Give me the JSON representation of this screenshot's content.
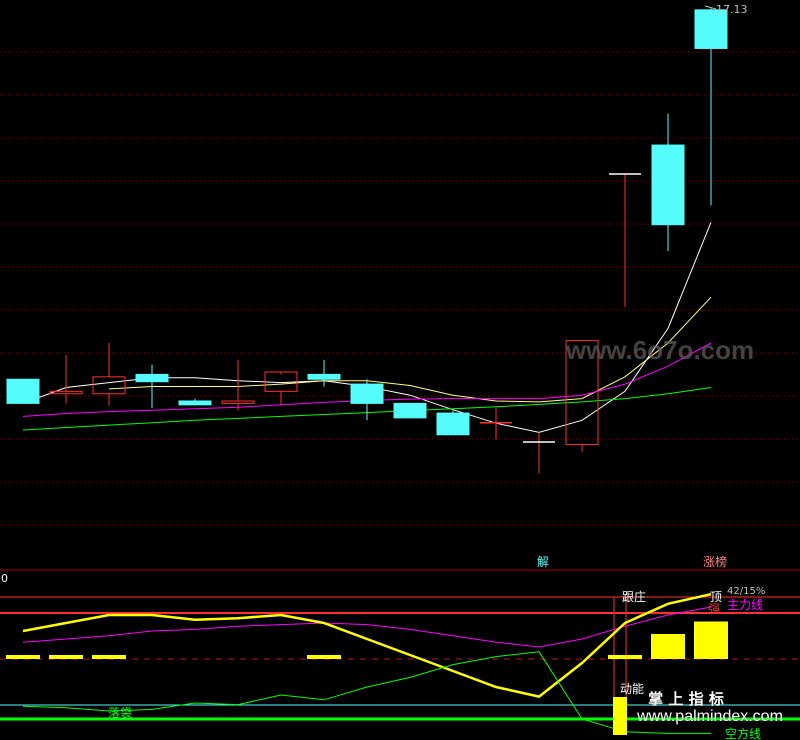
{
  "chart_data": [
    {
      "type": "candlestick",
      "panel": "main",
      "price_label": "17.13",
      "ylim": [
        5.5,
        17.2
      ],
      "candles": [
        {
          "o": 9.45,
          "h": 9.45,
          "l": 8.95,
          "c": 8.95
        },
        {
          "o": 9.15,
          "h": 9.95,
          "l": 8.95,
          "c": 9.2
        },
        {
          "o": 9.15,
          "h": 10.2,
          "l": 8.9,
          "c": 9.5
        },
        {
          "o": 9.55,
          "h": 9.75,
          "l": 8.85,
          "c": 9.4
        },
        {
          "o": 9.0,
          "h": 9.05,
          "l": 8.95,
          "c": 8.92
        },
        {
          "o": 8.95,
          "h": 9.85,
          "l": 8.8,
          "c": 9.0
        },
        {
          "o": 9.2,
          "h": 9.55,
          "l": 8.9,
          "c": 9.6
        },
        {
          "o": 9.55,
          "h": 9.85,
          "l": 9.3,
          "c": 9.45
        },
        {
          "o": 9.35,
          "h": 9.45,
          "l": 8.6,
          "c": 8.95
        },
        {
          "o": 8.95,
          "h": 8.95,
          "l": 8.7,
          "c": 8.65
        },
        {
          "o": 8.75,
          "h": 8.8,
          "l": 8.3,
          "c": 8.3
        },
        {
          "o": 8.55,
          "h": 8.85,
          "l": 8.2,
          "c": 8.55
        },
        {
          "o": 8.15,
          "h": 8.35,
          "l": 7.5,
          "c": 8.15
        },
        {
          "o": 8.1,
          "h": 10.25,
          "l": 7.95,
          "c": 10.25
        },
        {
          "o": 13.7,
          "h": 13.7,
          "l": 10.95,
          "c": 13.7
        },
        {
          "o": 14.3,
          "h": 14.95,
          "l": 12.1,
          "c": 12.65
        },
        {
          "o": 17.1,
          "h": 17.13,
          "l": 13.05,
          "c": 16.3
        }
      ],
      "series": [
        {
          "color": "#FFFFFF",
          "values": [
            8.95,
            9.28,
            9.38,
            9.48,
            9.48,
            9.42,
            9.38,
            9.42,
            9.3,
            9.12,
            8.82,
            8.54,
            8.35,
            8.6,
            9.2,
            10.5,
            12.7
          ]
        },
        {
          "color": "#FFFF80",
          "values": [
            null,
            null,
            9.25,
            9.3,
            9.3,
            9.3,
            9.35,
            9.42,
            9.42,
            9.32,
            9.12,
            9.0,
            8.98,
            9.05,
            9.5,
            10.2,
            11.15
          ]
        },
        {
          "color": "#FF00FF",
          "values": [
            8.68,
            8.74,
            8.78,
            8.81,
            8.84,
            8.87,
            8.92,
            8.97,
            9.01,
            9.04,
            9.05,
            9.05,
            9.05,
            9.12,
            9.35,
            9.72,
            10.2
          ]
        },
        {
          "color": "#00FF00",
          "values": [
            8.4,
            8.45,
            8.5,
            8.55,
            8.6,
            8.64,
            8.68,
            8.72,
            8.76,
            8.8,
            8.84,
            8.88,
            8.93,
            8.98,
            9.05,
            9.15,
            9.28
          ]
        }
      ],
      "markers": [
        {
          "text": "解",
          "index": 12
        },
        {
          "text": "涨榜",
          "index": 16
        }
      ]
    },
    {
      "type": "line",
      "panel": "indicator",
      "axis_label": "0",
      "ylim": [
        0,
        100
      ],
      "series": [
        {
          "name": "主力线",
          "color": "#FF00FF",
          "values": [
            58,
            60,
            62,
            65,
            66,
            68,
            69,
            70,
            69,
            66,
            62,
            58,
            55,
            60,
            68,
            75,
            80
          ]
        },
        {
          "color": "#FFFF00",
          "values": [
            65,
            70,
            75,
            75,
            72,
            73,
            75,
            70,
            60,
            50,
            40,
            30,
            24,
            45,
            70,
            82,
            88
          ]
        },
        {
          "color": "#00FF00",
          "values": [
            18,
            17,
            15,
            16,
            20,
            19,
            25,
            22,
            30,
            36,
            44,
            49,
            52,
            10,
            2,
            1,
            1
          ]
        }
      ],
      "yellow_bars": [
        {
          "index": 0,
          "value": 50
        },
        {
          "index": 1,
          "value": 50
        },
        {
          "index": 2,
          "value": 50
        },
        {
          "index": 7,
          "value": 50
        },
        {
          "index": 14,
          "value": 50
        },
        {
          "index": 15,
          "value": 55
        },
        {
          "index": 16,
          "value": 60
        }
      ],
      "labels": [
        "跟庄",
        "顶",
        "强",
        "主力线",
        "落袋",
        "动能",
        "空方线"
      ],
      "readout": "42/15%"
    }
  ],
  "watermark": {
    "top": "www.6o7o.com",
    "bottom_cn": "掌 上 指 标",
    "bottom_url": "www.palmindex.com"
  }
}
